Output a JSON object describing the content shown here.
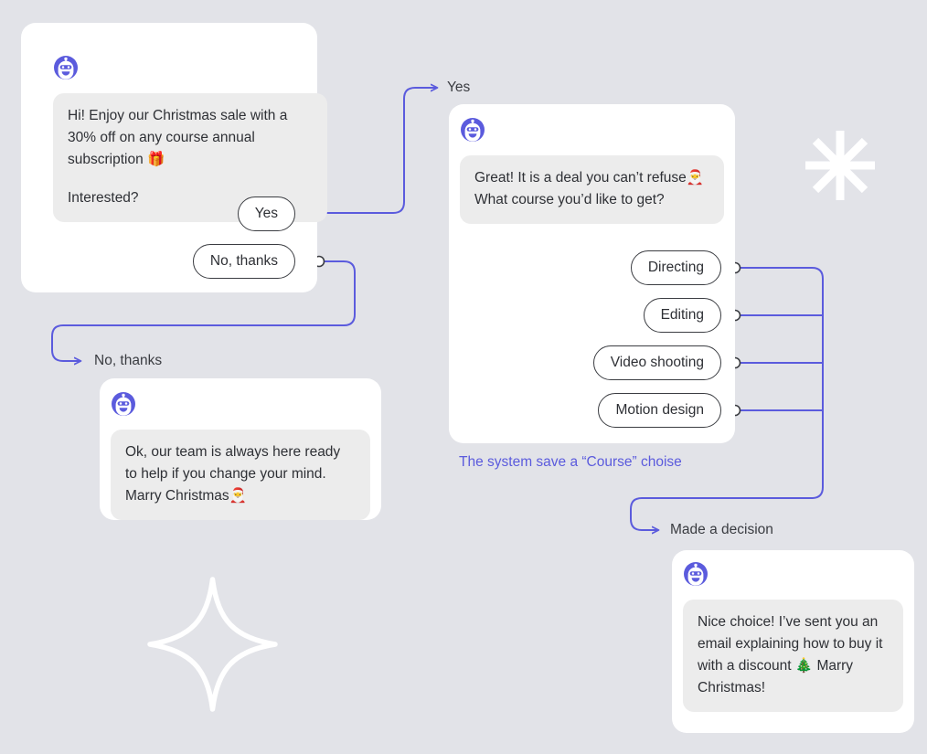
{
  "canvas": {
    "background_color": "#e2e3e8",
    "accent_color": "#5b5bdd",
    "bubble_color": "#ececec",
    "card_color": "#ffffff",
    "text_color": "#2e3035"
  },
  "cards": [
    {
      "id": "intro-card",
      "avatar": "bot-avatar-icon",
      "messages": [
        "Hi! Enjoy our Christmas sale with a 30% off on any course annual subscription 🎁",
        "Interested?"
      ],
      "options": [
        {
          "label": "Yes"
        },
        {
          "label": "No, thanks"
        }
      ]
    },
    {
      "id": "course-card",
      "avatar": "bot-avatar-icon",
      "messages": [
        "Great! It is a deal you can’t refuse🎅",
        "What course you’d like to get?"
      ],
      "options": [
        {
          "label": "Directing"
        },
        {
          "label": "Editing"
        },
        {
          "label": "Video shooting"
        },
        {
          "label": "Motion design"
        }
      ]
    },
    {
      "id": "decline-card",
      "avatar": "bot-avatar-icon",
      "messages": [
        "Ok, our team is always here ready to help if you change your mind. Marry Christmas🎅"
      ],
      "options": []
    },
    {
      "id": "confirm-card",
      "avatar": "bot-avatar-icon",
      "messages": [
        "Nice choice! I’ve sent you an email explaining how to buy it with a discount 🎄 Marry Christmas!"
      ],
      "options": []
    }
  ],
  "flow_labels": {
    "yes": "Yes",
    "no_thanks": "No, thanks",
    "made_a_decision": "Made a decision"
  },
  "notes": {
    "system_save": "The system save a “Course” choise"
  },
  "decorations": [
    {
      "name": "asterisk-star",
      "points": 8
    },
    {
      "name": "four-point-sparkle",
      "points": 4
    }
  ]
}
